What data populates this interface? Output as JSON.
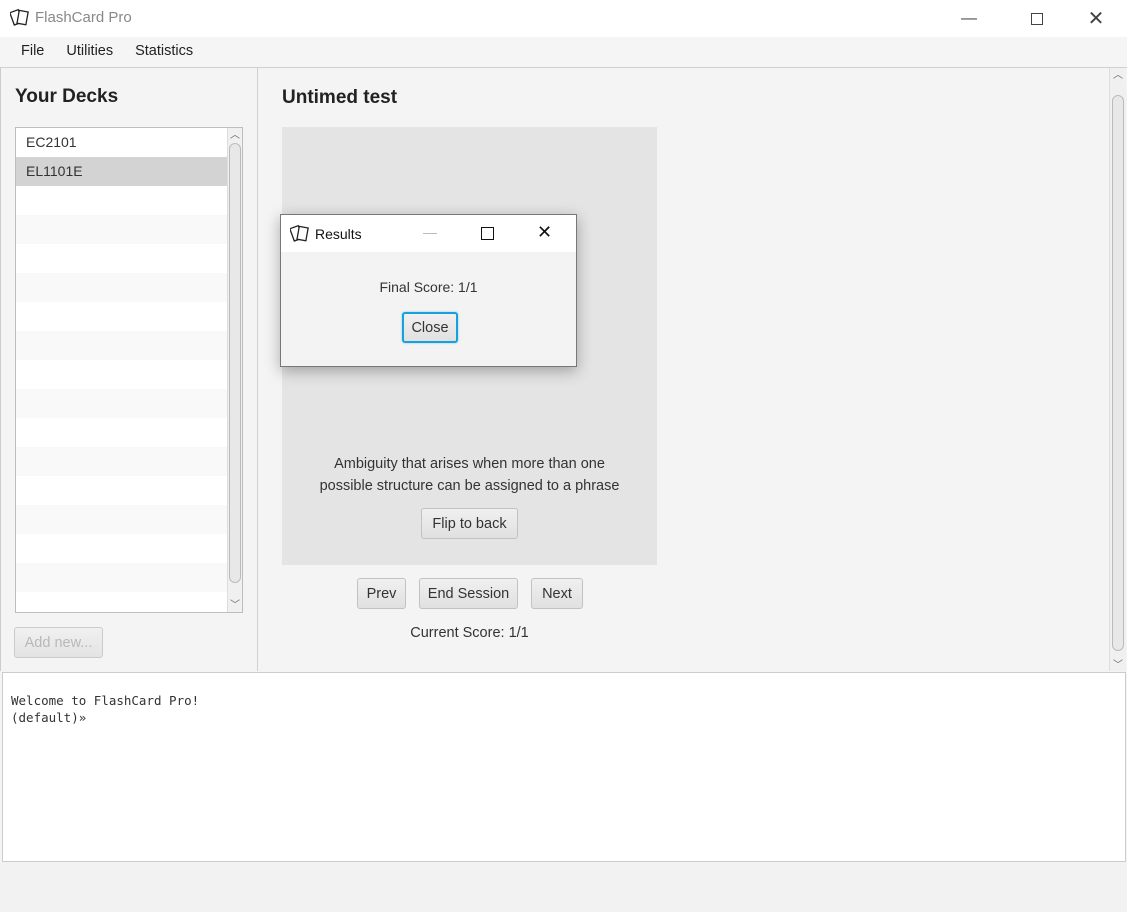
{
  "window": {
    "title": "FlashCard Pro",
    "icon": "cards-icon",
    "controls": [
      "minimize",
      "maximize",
      "close"
    ]
  },
  "menu": [
    "File",
    "Utilities",
    "Statistics"
  ],
  "sidebar": {
    "heading": "Your Decks",
    "decks": [
      {
        "name": "EC2101",
        "selected": false
      },
      {
        "name": "EL1101E",
        "selected": true
      }
    ],
    "add_button": "Add new..."
  },
  "main": {
    "title": "Untimed test",
    "card_text_line1": "Ambiguity that arises when more than one",
    "card_text_line2": "possible structure can be assigned to a phrase",
    "flip_button": "Flip to back",
    "prev_button": "Prev",
    "end_button": "End Session",
    "next_button": "Next",
    "current_score": "Current Score: 1/1"
  },
  "console": {
    "line1": "Welcome to FlashCard Pro!",
    "line2": "(default)»"
  },
  "dialog": {
    "title": "Results",
    "score": "Final Score: 1/1",
    "close_button": "Close",
    "focus_color": "#1a9fd9"
  }
}
